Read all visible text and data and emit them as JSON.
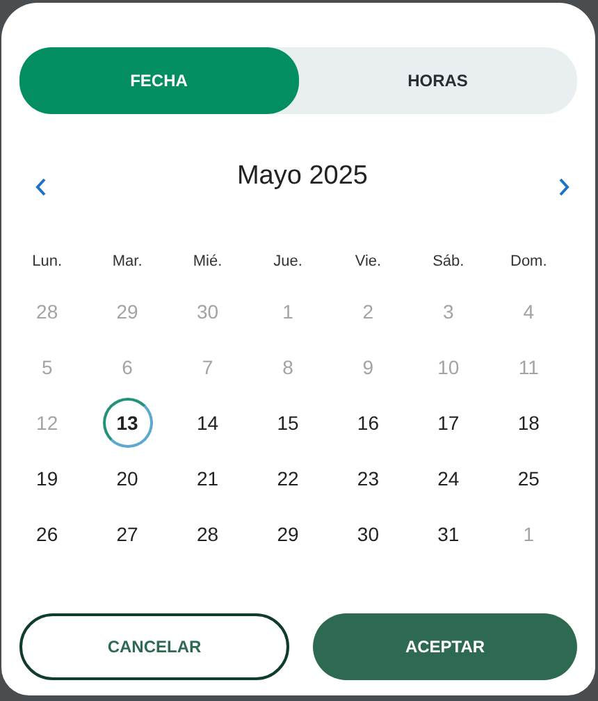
{
  "tabs": [
    {
      "label": "FECHA",
      "selected": true
    },
    {
      "label": "HORAS",
      "selected": false
    }
  ],
  "calendar": {
    "title": "Mayo 2025",
    "weekdays": [
      "Lun.",
      "Mar.",
      "Mié.",
      "Jue.",
      "Vie.",
      "Sáb.",
      "Dom."
    ],
    "days": [
      {
        "label": "28",
        "disabled": true,
        "selected": false
      },
      {
        "label": "29",
        "disabled": true,
        "selected": false
      },
      {
        "label": "30",
        "disabled": true,
        "selected": false
      },
      {
        "label": "1",
        "disabled": true,
        "selected": false
      },
      {
        "label": "2",
        "disabled": true,
        "selected": false
      },
      {
        "label": "3",
        "disabled": true,
        "selected": false
      },
      {
        "label": "4",
        "disabled": true,
        "selected": false
      },
      {
        "label": "5",
        "disabled": true,
        "selected": false
      },
      {
        "label": "6",
        "disabled": true,
        "selected": false
      },
      {
        "label": "7",
        "disabled": true,
        "selected": false
      },
      {
        "label": "8",
        "disabled": true,
        "selected": false
      },
      {
        "label": "9",
        "disabled": true,
        "selected": false
      },
      {
        "label": "10",
        "disabled": true,
        "selected": false
      },
      {
        "label": "11",
        "disabled": true,
        "selected": false
      },
      {
        "label": "12",
        "disabled": true,
        "selected": false
      },
      {
        "label": "13",
        "disabled": false,
        "selected": true
      },
      {
        "label": "14",
        "disabled": false,
        "selected": false
      },
      {
        "label": "15",
        "disabled": false,
        "selected": false
      },
      {
        "label": "16",
        "disabled": false,
        "selected": false
      },
      {
        "label": "17",
        "disabled": false,
        "selected": false
      },
      {
        "label": "18",
        "disabled": false,
        "selected": false
      },
      {
        "label": "19",
        "disabled": false,
        "selected": false
      },
      {
        "label": "20",
        "disabled": false,
        "selected": false
      },
      {
        "label": "21",
        "disabled": false,
        "selected": false
      },
      {
        "label": "22",
        "disabled": false,
        "selected": false
      },
      {
        "label": "23",
        "disabled": false,
        "selected": false
      },
      {
        "label": "24",
        "disabled": false,
        "selected": false
      },
      {
        "label": "25",
        "disabled": false,
        "selected": false
      },
      {
        "label": "26",
        "disabled": false,
        "selected": false
      },
      {
        "label": "27",
        "disabled": false,
        "selected": false
      },
      {
        "label": "28",
        "disabled": false,
        "selected": false
      },
      {
        "label": "29",
        "disabled": false,
        "selected": false
      },
      {
        "label": "30",
        "disabled": false,
        "selected": false
      },
      {
        "label": "31",
        "disabled": false,
        "selected": false
      },
      {
        "label": "1",
        "disabled": true,
        "selected": false
      }
    ]
  },
  "buttons": [
    {
      "label": "CANCELAR",
      "kind": "outline"
    },
    {
      "label": "ACEPTAR",
      "kind": "filled"
    }
  ]
}
